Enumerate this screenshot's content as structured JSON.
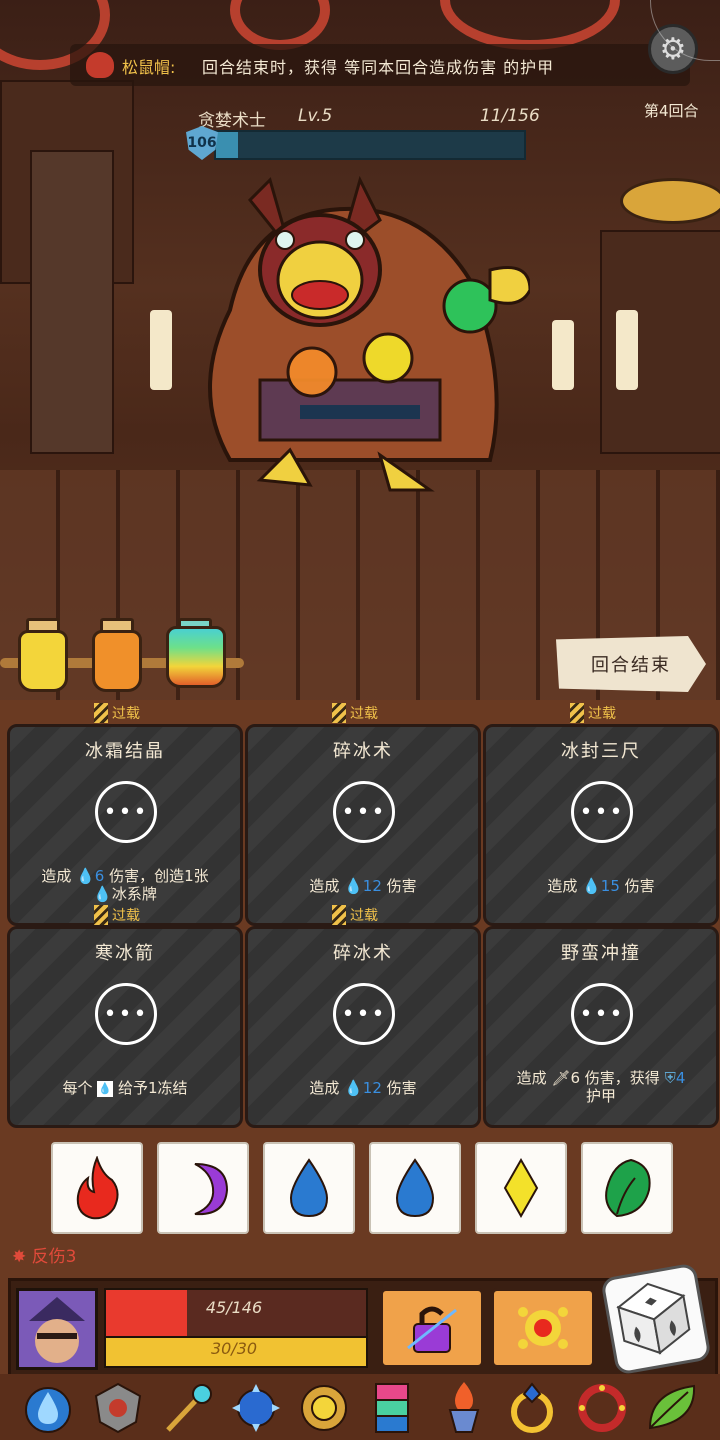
{
  "hud": {
    "buff_name": "松鼠帽:",
    "buff_text": "回合结束时，获得 等同本回合造成伤害 的护甲",
    "round": "第4回合"
  },
  "enemy": {
    "name": "贪婪术士",
    "level": "Lv.5",
    "hp_text": "11/156",
    "hp_fraction": 0.07,
    "shield": "106"
  },
  "potions": [
    "yellow-potion",
    "orange-potion",
    "rainbow-potion"
  ],
  "end_turn_label": "回合结束",
  "cards": [
    {
      "tag": "过载",
      "title": "冰霜结晶",
      "desc_a": "造成",
      "desc_val": "6",
      "desc_b": "伤害，创造1张",
      "desc_c": "冰系牌"
    },
    {
      "tag": "过载",
      "title": "碎冰术",
      "desc_a": "造成",
      "desc_val": "12",
      "desc_b": "伤害",
      "desc_c": ""
    },
    {
      "tag": "过载",
      "title": "冰封三尺",
      "desc_a": "造成",
      "desc_val": "15",
      "desc_b": "伤害",
      "desc_c": ""
    },
    {
      "tag": "过载",
      "title": "寒冰箭",
      "desc_a": "每个",
      "desc_val": "",
      "desc_b": "给予1冻结",
      "desc_c": ""
    },
    {
      "tag": "过载",
      "title": "碎冰术",
      "desc_a": "造成",
      "desc_val": "12",
      "desc_b": "伤害",
      "desc_c": ""
    },
    {
      "tag": "",
      "title": "野蛮冲撞",
      "desc_a": "造成",
      "desc_val": "6",
      "desc_b": "伤害，获得",
      "desc_val2": "4",
      "desc_c": "护甲"
    }
  ],
  "dice": [
    "fire",
    "moon",
    "water",
    "water",
    "lightning",
    "leaf"
  ],
  "player": {
    "status": "反伤3",
    "hp_text": "45/146",
    "hp_fraction": 0.31,
    "energy_text": "30/30"
  },
  "relics": [
    "water-drop-relic",
    "shield-relic",
    "wand-relic",
    "spiked-orb-relic",
    "amulet-relic",
    "totem-relic",
    "torch-relic",
    "ring-relic",
    "bracelet-relic",
    "leaf-relic"
  ],
  "colors": {
    "hp": "#e93a2e",
    "energy": "#f1c232",
    "water": "#3a8fe0",
    "gold": "#f0c14a"
  }
}
